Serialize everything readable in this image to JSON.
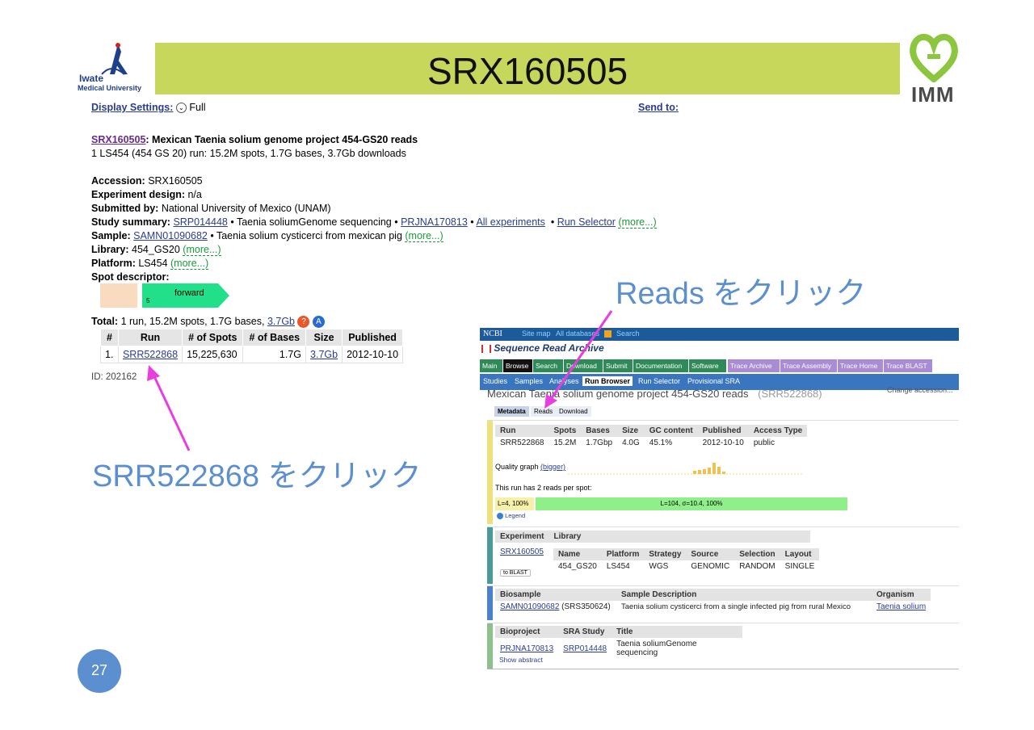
{
  "slide": {
    "title": "SRX160505",
    "logo_left_line1": "Iwate",
    "logo_left_line2": "Medical University",
    "logo_right": "IMM",
    "page_number": "27",
    "annotation_reads": "Reads をクリック",
    "annotation_run": "SRR522868 をクリック",
    "colors": {
      "title_bar": "#c6d75c",
      "annotation": "#5b8fcf",
      "arrow": "#e83ee0"
    }
  },
  "record": {
    "display_settings_label": "Display Settings:",
    "display_settings_value": "Full",
    "send_to_label": "Send to:",
    "accession_link": "SRX160505",
    "heading_text": ": Mexican Taenia solium genome project 454-GS20 reads",
    "summary_line": "1 LS454 (454 GS 20) run: 15.2M spots, 1.7G bases, 3.7Gb downloads",
    "accession_label": "Accession:",
    "accession_value": "SRX160505",
    "design_label": "Experiment design:",
    "design_value": "n/a",
    "submitted_label": "Submitted by:",
    "submitted_value": "National University of Mexico (UNAM)",
    "study_label": "Study summary:",
    "study_link": "SRP014448",
    "study_text": "• Taenia soliumGenome sequencing •",
    "bioproject_link": "PRJNA170813",
    "all_experiments_link": "All experiments",
    "run_selector_link": "Run Selector",
    "more_label": "(more...)",
    "sample_label": "Sample:",
    "sample_link": "SAMN01090682",
    "sample_text": "• Taenia solium cysticerci from mexican pig",
    "library_label": "Library:",
    "library_value": "454_GS20",
    "platform_label": "Platform:",
    "platform_value": "LS454",
    "spot_label": "Spot descriptor:",
    "spot_forward": "forward",
    "spot_num": "5",
    "total_label": "Total:",
    "total_text": "1 run, 15.2M spots, 1.7G bases,",
    "total_link": "3.7Gb",
    "runs_table": {
      "headers": [
        "#",
        "Run",
        "# of Spots",
        "# of Bases",
        "Size",
        "Published"
      ],
      "row": [
        "1.",
        "SRR522868",
        "15,225,630",
        "1.7G",
        "3.7Gb",
        "2012-10-10"
      ]
    },
    "id_text": "ID: 202162"
  },
  "sra": {
    "ncbi_logo": "NCBI",
    "site_map": "Site map",
    "all_databases": "All databases",
    "search_top": "Search",
    "app_title": "Sequence Read Archive",
    "nav1": [
      "Main",
      "Browse",
      "Search",
      "Download",
      "Submit",
      "Documentation",
      "Software",
      "Trace Archive",
      "Trace Assembly",
      "Trace Home",
      "Trace BLAST"
    ],
    "nav2": [
      "Studies",
      "Samples",
      "Analyses",
      "Run Browser",
      "Run Selector",
      "Provisional SRA"
    ],
    "change_accession": "Change accession...",
    "experiment_title": "Mexican Taenia solium genome project 454-GS20 reads",
    "experiment_acc": "(SRR522868)",
    "subtabs": [
      "Metadata",
      "Reads",
      "Download"
    ],
    "run_headers": [
      "Run",
      "Spots",
      "Bases",
      "Size",
      "GC content",
      "Published",
      "Access Type"
    ],
    "run_row": [
      "SRR522868",
      "15.2M",
      "1.7Gbp",
      "4.0G",
      "45.1%",
      "2012-10-10",
      "public"
    ],
    "quality_label": "Quality graph",
    "quality_link": "(bigger)",
    "reads_per_spot": "This run has 2 reads per spot:",
    "read1": "L=4, 100%",
    "read2": "L=104, σ=10.4, 100%",
    "legend": "Legend",
    "exp_headers": [
      "Experiment",
      "Library"
    ],
    "exp_link": "SRX160505",
    "to_blast": "to BLAST",
    "lib_headers": [
      "Name",
      "Platform",
      "Strategy",
      "Source",
      "Selection",
      "Layout"
    ],
    "lib_row": [
      "454_GS20",
      "LS454",
      "WGS",
      "GENOMIC",
      "RANDOM",
      "SINGLE"
    ],
    "bio_headers": [
      "Biosample",
      "Sample Description",
      "Organism"
    ],
    "bio_link": "SAMN01090682",
    "bio_srs": "(SRS350624)",
    "bio_desc": "Taenia solium cysticerci from a single infected pig from rural Mexico",
    "organism": "Taenia solium",
    "proj_headers": [
      "Bioproject",
      "SRA Study",
      "Title"
    ],
    "proj_link": "PRJNA170813",
    "study_link": "SRP014448",
    "proj_title": "Taenia soliumGenome sequencing",
    "show_abstract": "Show abstract"
  }
}
